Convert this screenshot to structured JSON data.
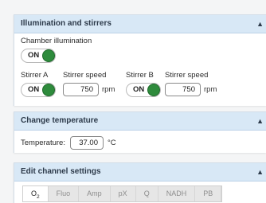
{
  "illumination_panel": {
    "title": "Illumination and stirrers",
    "chamber_illumination_label": "Chamber illumination",
    "chamber_illumination_state": "ON",
    "stirrer_a_label": "Stirrer A",
    "stirrer_a_state": "ON",
    "stirrer_a_speed_label": "Stirrer speed",
    "stirrer_a_speed_value": "750",
    "stirrer_a_speed_unit": "rpm",
    "stirrer_b_label": "Stirrer B",
    "stirrer_b_state": "ON",
    "stirrer_b_speed_label": "Stirrer speed",
    "stirrer_b_speed_value": "750",
    "stirrer_b_speed_unit": "rpm"
  },
  "temperature_panel": {
    "title": "Change temperature",
    "temperature_label": "Temperature:",
    "temperature_value": "37.00",
    "temperature_unit": "°C"
  },
  "channel_panel": {
    "title": "Edit channel settings",
    "tabs": [
      {
        "label_main": "O",
        "label_sub": "2"
      },
      {
        "label_main": "Fluo",
        "label_sub": ""
      },
      {
        "label_main": "Amp",
        "label_sub": ""
      },
      {
        "label_main": "pX",
        "label_sub": ""
      },
      {
        "label_main": "Q",
        "label_sub": ""
      },
      {
        "label_main": "NADH",
        "label_sub": ""
      },
      {
        "label_main": "PB",
        "label_sub": ""
      }
    ]
  },
  "colors": {
    "header_bg": "#d8e8f6",
    "toggle_on": "#2e8b3c"
  },
  "icons": {
    "panel_caret": "caret-up-icon"
  }
}
